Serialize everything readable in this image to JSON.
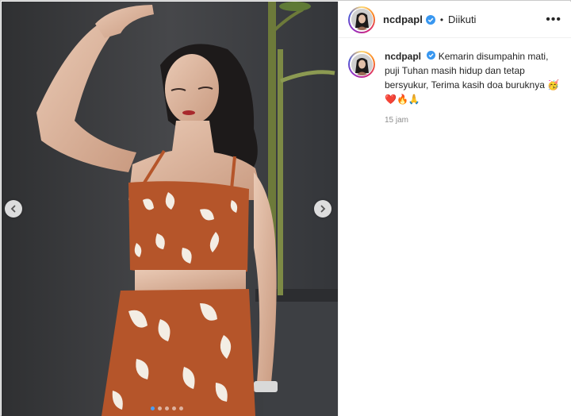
{
  "post": {
    "username": "ncdpapl",
    "follow_status": "Diikuti",
    "separator": "•",
    "more_label": "•••"
  },
  "caption": {
    "username": "ncdpapl",
    "text": "Kemarin disumpahin mati, puji Tuhan masih hidup dan tetap bersyukur, Terima kasih doa buruknya",
    "emojis": "🥳❤️🔥🙏",
    "time": "15 jam"
  },
  "carousel": {
    "prev_icon": "chevron-left-icon",
    "next_icon": "chevron-right-icon",
    "slide_count": 5,
    "active_slide": 1
  },
  "colors": {
    "verified": "#3897f0",
    "wall": "#3a3b3d",
    "outfit": "#b5552a",
    "pattern": "#f3ede4"
  }
}
